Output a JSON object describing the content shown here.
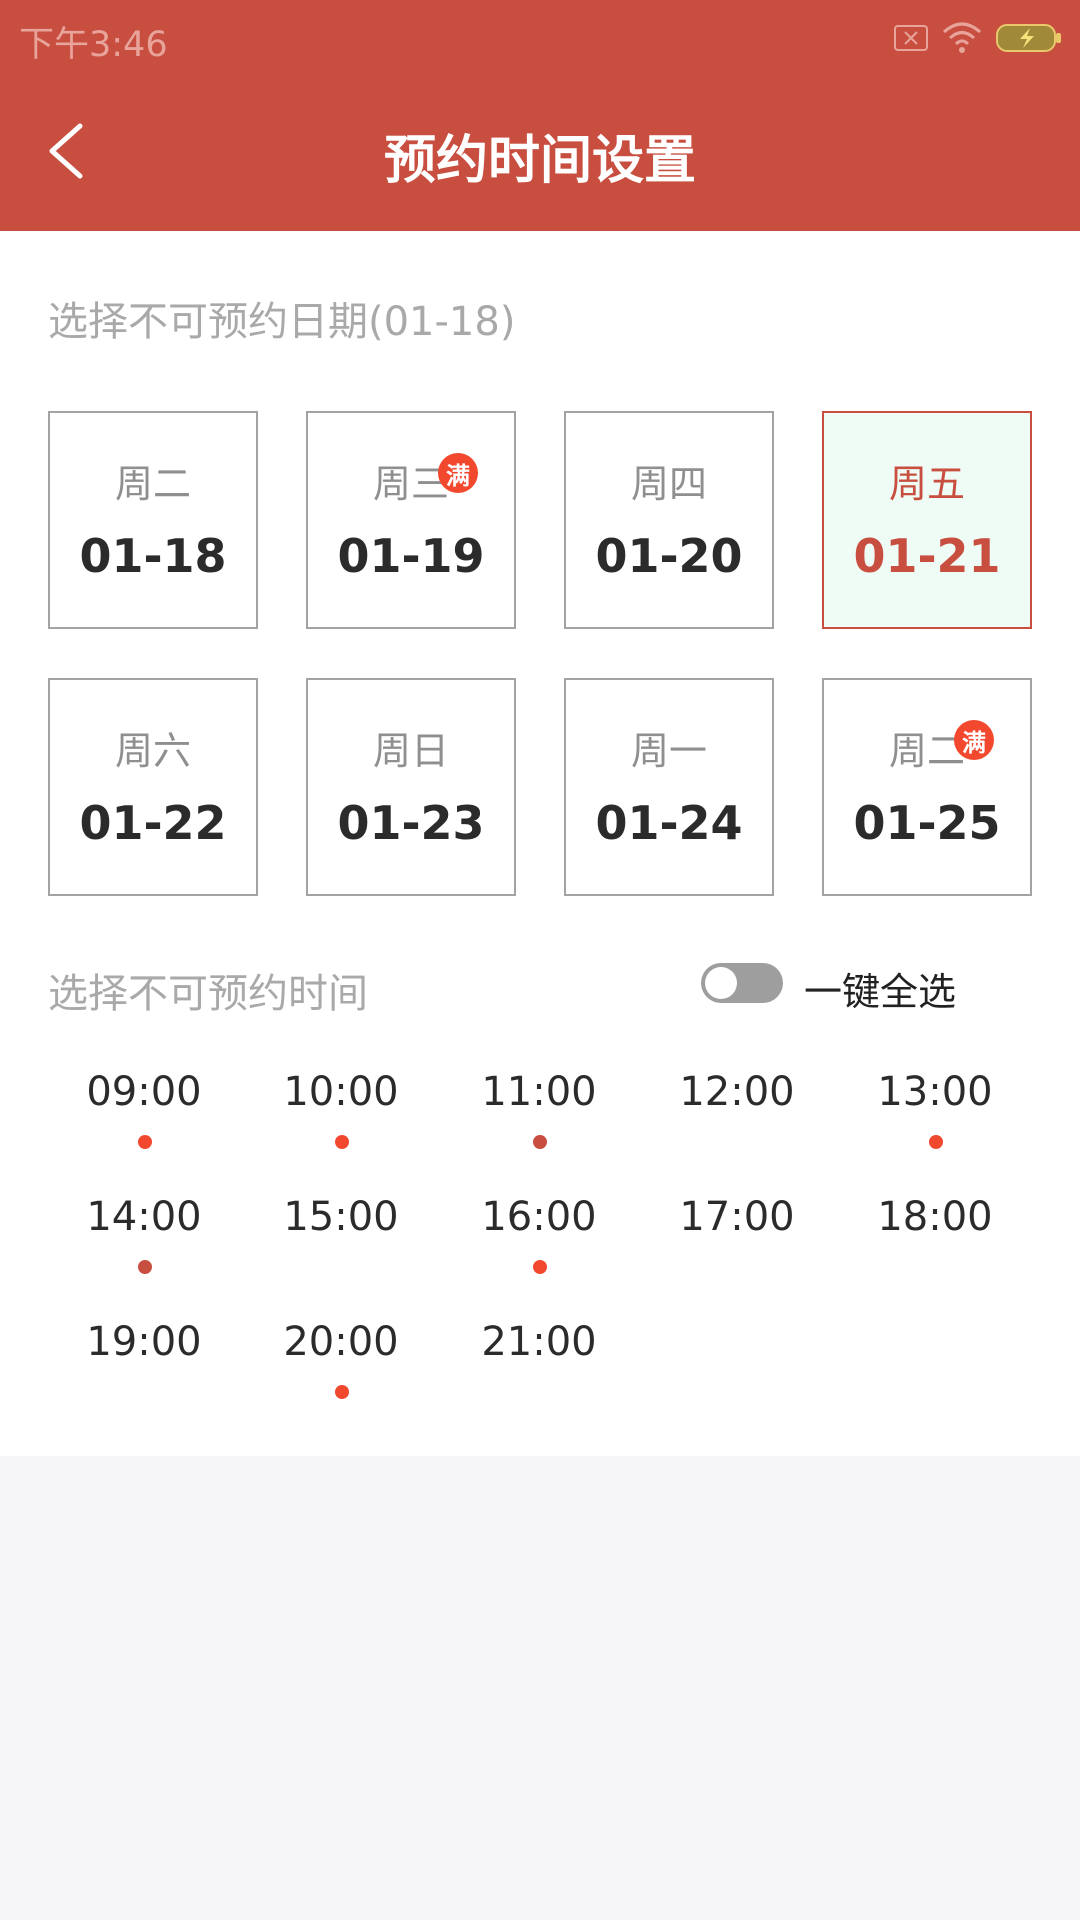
{
  "status_bar": {
    "time": "下午3:46",
    "icons": [
      "sim-error-icon",
      "wifi-icon",
      "battery-charging-icon"
    ]
  },
  "header": {
    "title": "预约时间设置",
    "back_icon": "chevron-left-icon"
  },
  "date_section": {
    "label": "选择不可预约日期(01-18)",
    "dates": [
      {
        "weekday": "周二",
        "date": "01-18",
        "full": false,
        "selected": false
      },
      {
        "weekday": "周三",
        "date": "01-19",
        "full": true,
        "selected": false
      },
      {
        "weekday": "周四",
        "date": "01-20",
        "full": false,
        "selected": false
      },
      {
        "weekday": "周五",
        "date": "01-21",
        "full": false,
        "selected": true
      },
      {
        "weekday": "周六",
        "date": "01-22",
        "full": false,
        "selected": false
      },
      {
        "weekday": "周日",
        "date": "01-23",
        "full": false,
        "selected": false
      },
      {
        "weekday": "周一",
        "date": "01-24",
        "full": false,
        "selected": false
      },
      {
        "weekday": "周二",
        "date": "01-25",
        "full": true,
        "selected": false
      }
    ],
    "full_badge": "满"
  },
  "time_section": {
    "label": "选择不可预约时间",
    "select_all_label": "一键全选",
    "select_all_on": false,
    "slots": [
      {
        "time": "09:00",
        "dot": "#f2482e"
      },
      {
        "time": "10:00",
        "dot": "#f2482e"
      },
      {
        "time": "11:00",
        "dot": "#c84e40"
      },
      {
        "time": "12:00",
        "dot": null
      },
      {
        "time": "13:00",
        "dot": "#f2482e"
      },
      {
        "time": "14:00",
        "dot": "#c84e40"
      },
      {
        "time": "15:00",
        "dot": null
      },
      {
        "time": "16:00",
        "dot": "#f2482e"
      },
      {
        "time": "17:00",
        "dot": null
      },
      {
        "time": "18:00",
        "dot": null
      },
      {
        "time": "19:00",
        "dot": null
      },
      {
        "time": "20:00",
        "dot": "#f2482e"
      },
      {
        "time": "21:00",
        "dot": null
      }
    ]
  },
  "colors": {
    "brand": "#c84e40",
    "badge": "#f2482e",
    "selected_bg": "#eefcf5"
  }
}
